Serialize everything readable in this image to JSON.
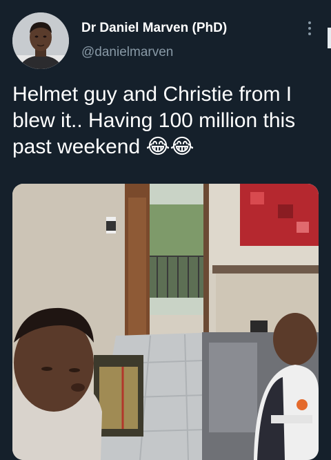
{
  "tweet": {
    "author_name": "Dr Daniel Marven (PhD)",
    "author_handle": "@danielmarven",
    "text": "Helmet guy and Christie from I blew it.. Having 100 million this past weekend 😂😂"
  },
  "icons": {
    "more": "more-vertical-icon",
    "avatar": "profile-photo"
  },
  "colors": {
    "background": "#15202b",
    "secondary_text": "#8899a6",
    "primary_text": "#ffffff"
  }
}
